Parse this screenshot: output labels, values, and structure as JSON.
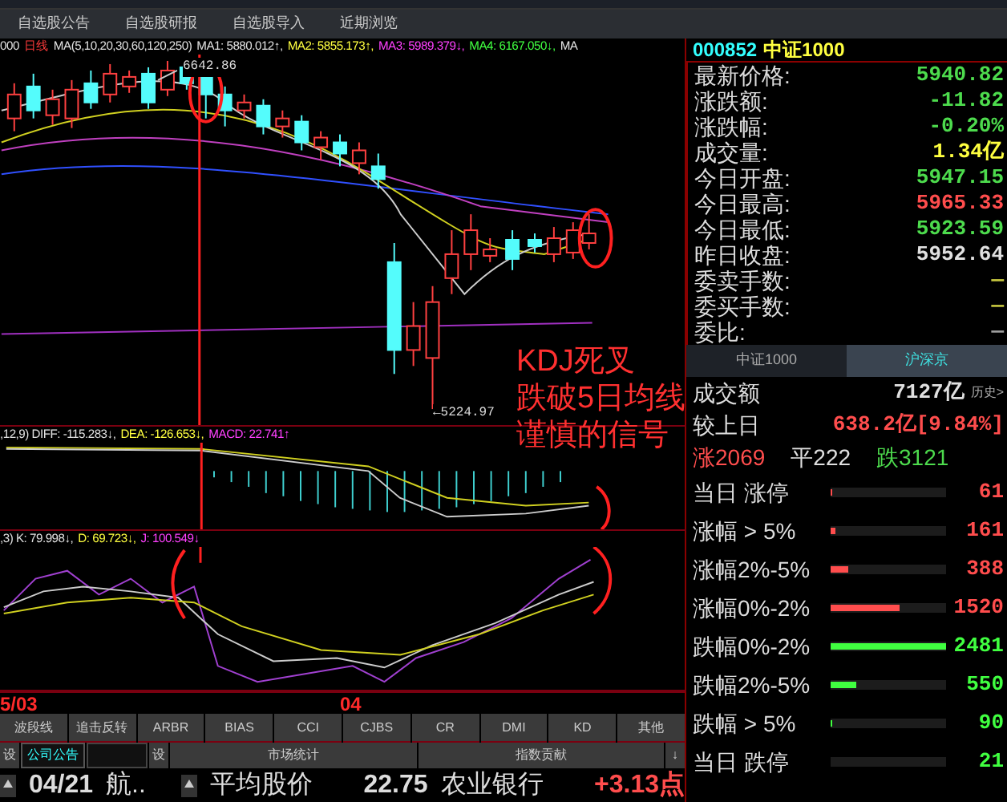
{
  "toolbar": [
    "自选股公告",
    "自选股研报",
    "自选股导入",
    "近期浏览"
  ],
  "chart_header": [
    {
      "text": "000",
      "color": "#e0e0e0"
    },
    {
      "text": "日线",
      "color": "#ff3b3b"
    },
    {
      "text": "MA(5,10,20,30,60,120,250)",
      "color": "#e0e0e0"
    },
    {
      "text": "MA1: 5880.012↑,",
      "color": "#e0e0e0"
    },
    {
      "text": "MA2: 5855.173↑,",
      "color": "#ffff40"
    },
    {
      "text": "MA3: 5989.379↓,",
      "color": "#ff40ff"
    },
    {
      "text": "MA4: 6167.050↓,",
      "color": "#40ff40"
    },
    {
      "text": "MA",
      "color": "#e0e0e0"
    }
  ],
  "price_labels": {
    "high": "6642.86",
    "low": "←5224.97"
  },
  "annotation": [
    "KDJ死叉",
    "跌破5日均线",
    "谨慎的信号"
  ],
  "macd_header": [
    {
      "text": ",12,9) DIFF: -115.283↓,",
      "color": "#e0e0e0"
    },
    {
      "text": "DEA: -126.653↓,",
      "color": "#ffff40"
    },
    {
      "text": "MACD: 22.741↑",
      "color": "#ff40ff"
    }
  ],
  "kdj_header": [
    {
      "text": ",3) K: 79.998↓,",
      "color": "#e0e0e0"
    },
    {
      "text": "D: 69.723↓,",
      "color": "#ffff40"
    },
    {
      "text": "J: 100.549↓",
      "color": "#ff40ff"
    }
  ],
  "date_axis": [
    "5/03",
    "04"
  ],
  "indicator_tabs": [
    "波段线",
    "追击反转",
    "ARBR",
    "BIAS",
    "CCI",
    "CJBS",
    "CR",
    "DMI",
    "KD",
    "其他"
  ],
  "bottom_bar": {
    "left_settings": "设",
    "left_tab": "公司公告",
    "right_settings": "设",
    "panels": [
      "市场统计",
      "指数贡献"
    ],
    "menu": "↓"
  },
  "news": {
    "date": "04/21",
    "title": "航.."
  },
  "market_stat": {
    "label": "平均股价",
    "value": "22.75"
  },
  "index_contribution": {
    "name": "农业银行",
    "value": "+3.13点"
  },
  "quote": {
    "code": "000852",
    "name": "中证1000",
    "rows": [
      {
        "label": "最新价格:",
        "value": "5940.82",
        "color": "#4ddb4d"
      },
      {
        "label": "涨跌额:",
        "value": "-11.82",
        "color": "#4ddb4d"
      },
      {
        "label": "涨跌幅:",
        "value": "-0.20%",
        "color": "#4ddb4d"
      },
      {
        "label": "成交量:",
        "value": "1.34亿",
        "color": "#ffff40"
      },
      {
        "label": "今日开盘:",
        "value": "5947.15",
        "color": "#4ddb4d"
      },
      {
        "label": "今日最高:",
        "value": "5965.33",
        "color": "#ff4d4d"
      },
      {
        "label": "今日最低:",
        "value": "5923.59",
        "color": "#4ddb4d"
      },
      {
        "label": "昨日收盘:",
        "value": "5952.64",
        "color": "#e0e0e0"
      },
      {
        "label": "委卖手数:",
        "value": "—",
        "color": "#c8c840"
      },
      {
        "label": "委买手数:",
        "value": "—",
        "color": "#c8c840"
      },
      {
        "label": "委比:",
        "value": "—",
        "color": "#a0a0a0"
      }
    ]
  },
  "breadth_tabs": [
    {
      "label": "中证1000",
      "selected": false
    },
    {
      "label": "沪深京",
      "selected": true
    }
  ],
  "turnover": {
    "label": "成交额",
    "value": "7127亿",
    "link": "历史>"
  },
  "vs_previous": {
    "label": "较上日",
    "value": "638.2亿[9.84%]"
  },
  "counts": [
    {
      "label": "涨",
      "value": "2069",
      "color": "#ff4d4d"
    },
    {
      "label": "平",
      "value": "222",
      "color": "#e0e0e0"
    },
    {
      "label": "跌",
      "value": "3121",
      "color": "#4ddb4d"
    }
  ],
  "distribution": [
    {
      "label": "当日 涨停",
      "count": "61",
      "level": 0.01,
      "color": "#ff4d4d"
    },
    {
      "label": "涨幅 > 5%",
      "count": "161",
      "level": 0.04,
      "color": "#ff4d4d"
    },
    {
      "label": "涨幅2%-5%",
      "count": "388",
      "level": 0.15,
      "color": "#ff4d4d"
    },
    {
      "label": "涨幅0%-2%",
      "count": "1520",
      "level": 0.6,
      "color": "#ff4d4d"
    },
    {
      "label": "跌幅0%-2%",
      "count": "2481",
      "level": 1.0,
      "color": "#40ff40"
    },
    {
      "label": "跌幅2%-5%",
      "count": "550",
      "level": 0.22,
      "color": "#40ff40"
    },
    {
      "label": "跌幅 > 5%",
      "count": "90",
      "level": 0.01,
      "color": "#40ff40"
    },
    {
      "label": "当日 跌停",
      "count": "21",
      "color": "#40ff40"
    }
  ]
}
